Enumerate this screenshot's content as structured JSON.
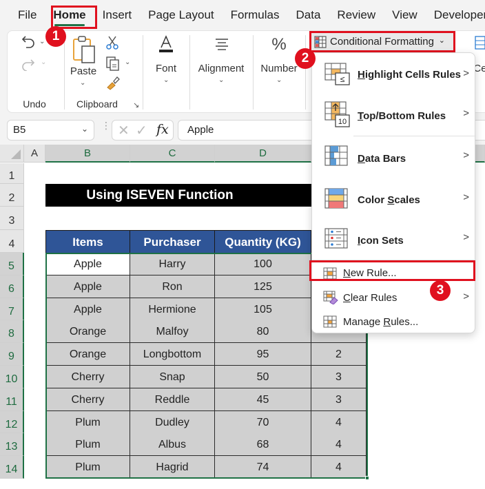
{
  "tabs": [
    {
      "label": "File",
      "active": false
    },
    {
      "label": "Home",
      "active": true
    },
    {
      "label": "Insert",
      "active": false
    },
    {
      "label": "Page Layout",
      "active": false
    },
    {
      "label": "Formulas",
      "active": false
    },
    {
      "label": "Data",
      "active": false
    },
    {
      "label": "Review",
      "active": false
    },
    {
      "label": "View",
      "active": false
    },
    {
      "label": "Developer",
      "active": false
    }
  ],
  "ribbon": {
    "undo_group": "Undo",
    "clipboard_group": "Clipboard",
    "paste_label": "Paste",
    "font_label": "Font",
    "alignment_label": "Alignment",
    "number_label": "Number",
    "number_glyph": "%",
    "cells_partial": "Ce",
    "conditional_formatting_label": "Conditional Formatting"
  },
  "formula_bar": {
    "name_box": "B5",
    "fx_label": "fx",
    "formula_value": "Apple"
  },
  "sheet": {
    "columns": [
      "A",
      "B",
      "C",
      "D"
    ],
    "rows": [
      "1",
      "2",
      "3",
      "4",
      "5",
      "6",
      "7",
      "8",
      "9",
      "10",
      "11",
      "12",
      "13",
      "14"
    ],
    "selected_column": "B",
    "selected_row": "5",
    "title": "Using ISEVEN Function",
    "table_headers": [
      "Items",
      "Purchaser",
      "Quantity (KG)"
    ],
    "table_rows": [
      {
        "item": "Apple",
        "purchaser": "Harry",
        "quantity": "100",
        "extra": ""
      },
      {
        "item": "Apple",
        "purchaser": "Ron",
        "quantity": "125",
        "extra": ""
      },
      {
        "item": "Apple",
        "purchaser": "Hermione",
        "quantity": "105",
        "extra": ""
      },
      {
        "item": "Orange",
        "purchaser": "Malfoy",
        "quantity": "80",
        "extra": ""
      },
      {
        "item": "Orange",
        "purchaser": "Longbottom",
        "quantity": "95",
        "extra": "2"
      },
      {
        "item": "Cherry",
        "purchaser": "Snap",
        "quantity": "50",
        "extra": "3"
      },
      {
        "item": "Cherry",
        "purchaser": "Reddle",
        "quantity": "45",
        "extra": "3"
      },
      {
        "item": "Plum",
        "purchaser": "Dudley",
        "quantity": "70",
        "extra": "4"
      },
      {
        "item": "Plum",
        "purchaser": "Albus",
        "quantity": "68",
        "extra": "4"
      },
      {
        "item": "Plum",
        "purchaser": "Hagrid",
        "quantity": "74",
        "extra": "4"
      }
    ]
  },
  "cf_menu": {
    "items": [
      {
        "label": "Highlight Cells Rules",
        "underline": "H",
        "rest": "ighlight Cells Rules",
        "submenu": true
      },
      {
        "label": "Top/Bottom Rules",
        "underline": "T",
        "rest": "op/Bottom Rules",
        "submenu": true
      },
      {
        "label": "Data Bars",
        "underline": "D",
        "rest": "ata Bars",
        "submenu": true
      },
      {
        "label": "Color Scales",
        "pre": "Color ",
        "underline": "S",
        "rest": "cales",
        "submenu": true
      },
      {
        "label": "Icon Sets",
        "underline": "I",
        "rest": "con Sets",
        "submenu": true
      },
      {
        "label": "New Rule...",
        "underline": "N",
        "rest": "ew Rule...",
        "submenu": false
      },
      {
        "label": "Clear Rules",
        "underline": "C",
        "rest": "lear Rules",
        "submenu": true
      },
      {
        "label": "Manage Rules...",
        "pre": "Manage ",
        "underline": "R",
        "rest": "ules...",
        "submenu": false
      }
    ],
    "arrow": ">"
  },
  "annotations": {
    "step1": "1",
    "step2": "2",
    "step3": "3",
    "highlight_color": "#e0101e"
  },
  "colors": {
    "accent_green": "#1e7145",
    "table_header_blue": "#2f5597",
    "cell_gray": "#d0d0d0"
  }
}
